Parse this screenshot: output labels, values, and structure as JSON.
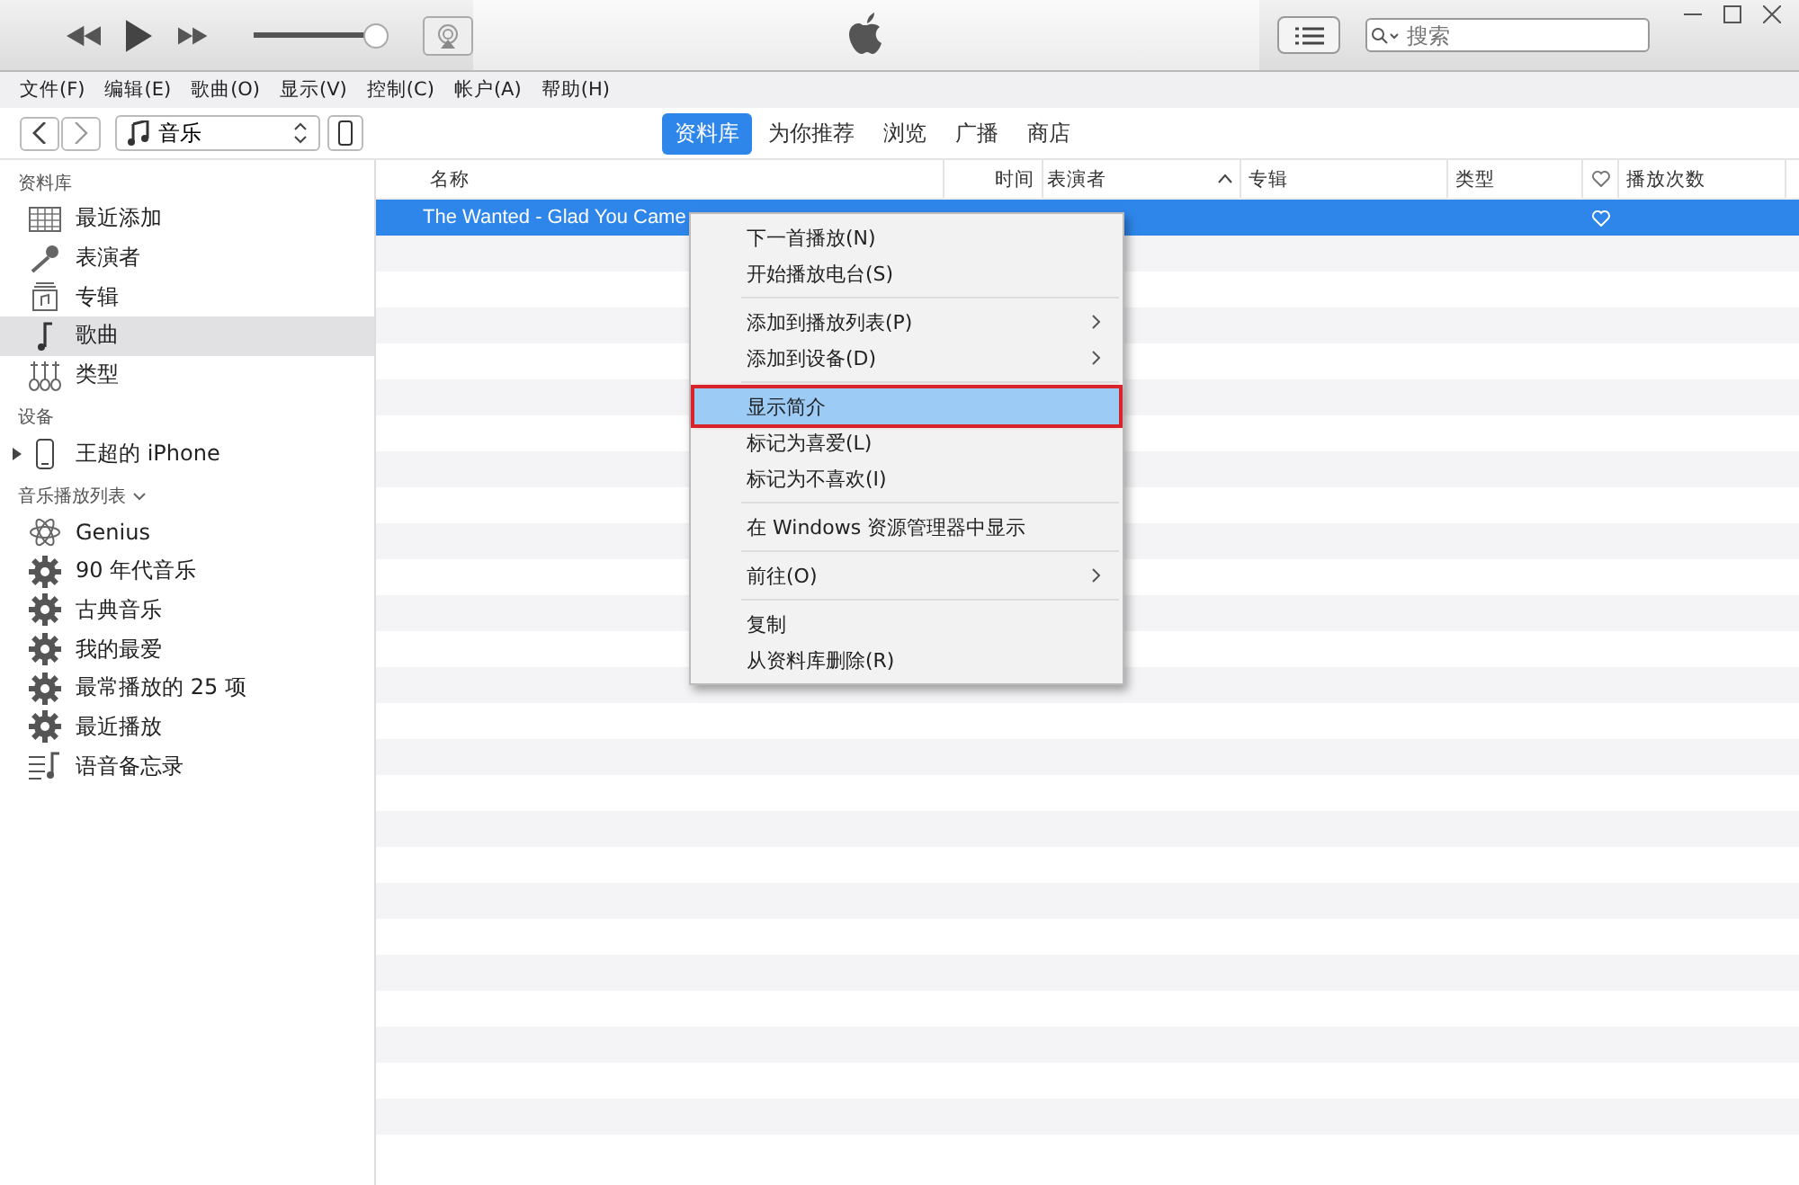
{
  "player": {
    "volume": {
      "level": 0.92
    },
    "search": {
      "placeholder": "搜索"
    }
  },
  "menu_bar": [
    "文件(F)",
    "编辑(E)",
    "歌曲(O)",
    "显示(V)",
    "控制(C)",
    "帐户(A)",
    "帮助(H)"
  ],
  "nav": {
    "media_picker": "音乐",
    "tabs": [
      {
        "label": "资料库",
        "selected": true
      },
      {
        "label": "为你推荐",
        "selected": false
      },
      {
        "label": "浏览",
        "selected": false
      },
      {
        "label": "广播",
        "selected": false
      },
      {
        "label": "商店",
        "selected": false
      }
    ]
  },
  "sidebar": {
    "sections": [
      {
        "title": "资料库",
        "items": [
          {
            "label": "最近添加",
            "kind": "recent",
            "selected": false
          },
          {
            "label": "表演者",
            "kind": "artists",
            "selected": false
          },
          {
            "label": "专辑",
            "kind": "albums",
            "selected": false
          },
          {
            "label": "歌曲",
            "kind": "songs",
            "selected": true
          },
          {
            "label": "类型",
            "kind": "genres",
            "selected": false
          }
        ]
      },
      {
        "title": "设备",
        "items": [
          {
            "label": "王超的 iPhone",
            "kind": "device",
            "selected": false
          }
        ]
      },
      {
        "title": "音乐播放列表",
        "collapsible": true,
        "items": [
          {
            "label": "Genius",
            "kind": "genius",
            "selected": false
          },
          {
            "label": "90 年代音乐",
            "kind": "smart",
            "selected": false
          },
          {
            "label": "古典音乐",
            "kind": "smart",
            "selected": false
          },
          {
            "label": "我的最爱",
            "kind": "smart",
            "selected": false
          },
          {
            "label": "最常播放的 25 项",
            "kind": "smart",
            "selected": false
          },
          {
            "label": "最近播放",
            "kind": "smart",
            "selected": false
          },
          {
            "label": "语音备忘录",
            "kind": "memo",
            "selected": false
          }
        ]
      }
    ]
  },
  "table": {
    "columns": [
      {
        "label": "名称",
        "kind": "text"
      },
      {
        "label": "时间",
        "kind": "time"
      },
      {
        "label": "表演者",
        "kind": "sorted"
      },
      {
        "label": "专辑",
        "kind": "text"
      },
      {
        "label": "类型",
        "kind": "text"
      },
      {
        "kind": "heart"
      },
      {
        "label": "播放次数",
        "kind": "text"
      }
    ],
    "rows": [
      {
        "name": "The Wanted - Glad You Came",
        "selected": true
      }
    ]
  },
  "context_menu": [
    {
      "kind": "item",
      "label": "下一首播放(N)",
      "submenu": false,
      "selected": false
    },
    {
      "kind": "item",
      "label": "开始播放电台(S)",
      "submenu": false,
      "selected": false
    },
    {
      "kind": "separator"
    },
    {
      "kind": "item",
      "label": "添加到播放列表(P)",
      "submenu": true,
      "selected": false
    },
    {
      "kind": "item",
      "label": "添加到设备(D)",
      "submenu": true,
      "selected": false
    },
    {
      "kind": "separator"
    },
    {
      "kind": "item",
      "label": "显示简介",
      "submenu": false,
      "selected": true
    },
    {
      "kind": "item",
      "label": "标记为喜爱(L)",
      "submenu": false,
      "selected": false
    },
    {
      "kind": "item",
      "label": "标记为不喜欢(I)",
      "submenu": false,
      "selected": false
    },
    {
      "kind": "separator"
    },
    {
      "kind": "item",
      "label": "在 Windows 资源管理器中显示",
      "submenu": false,
      "selected": false
    },
    {
      "kind": "separator"
    },
    {
      "kind": "item",
      "label": "前往(O)",
      "submenu": true,
      "selected": false
    },
    {
      "kind": "separator"
    },
    {
      "kind": "item",
      "label": "复制",
      "submenu": false,
      "selected": false
    },
    {
      "kind": "item",
      "label": "从资料库删除(R)",
      "submenu": false,
      "selected": false
    }
  ]
}
